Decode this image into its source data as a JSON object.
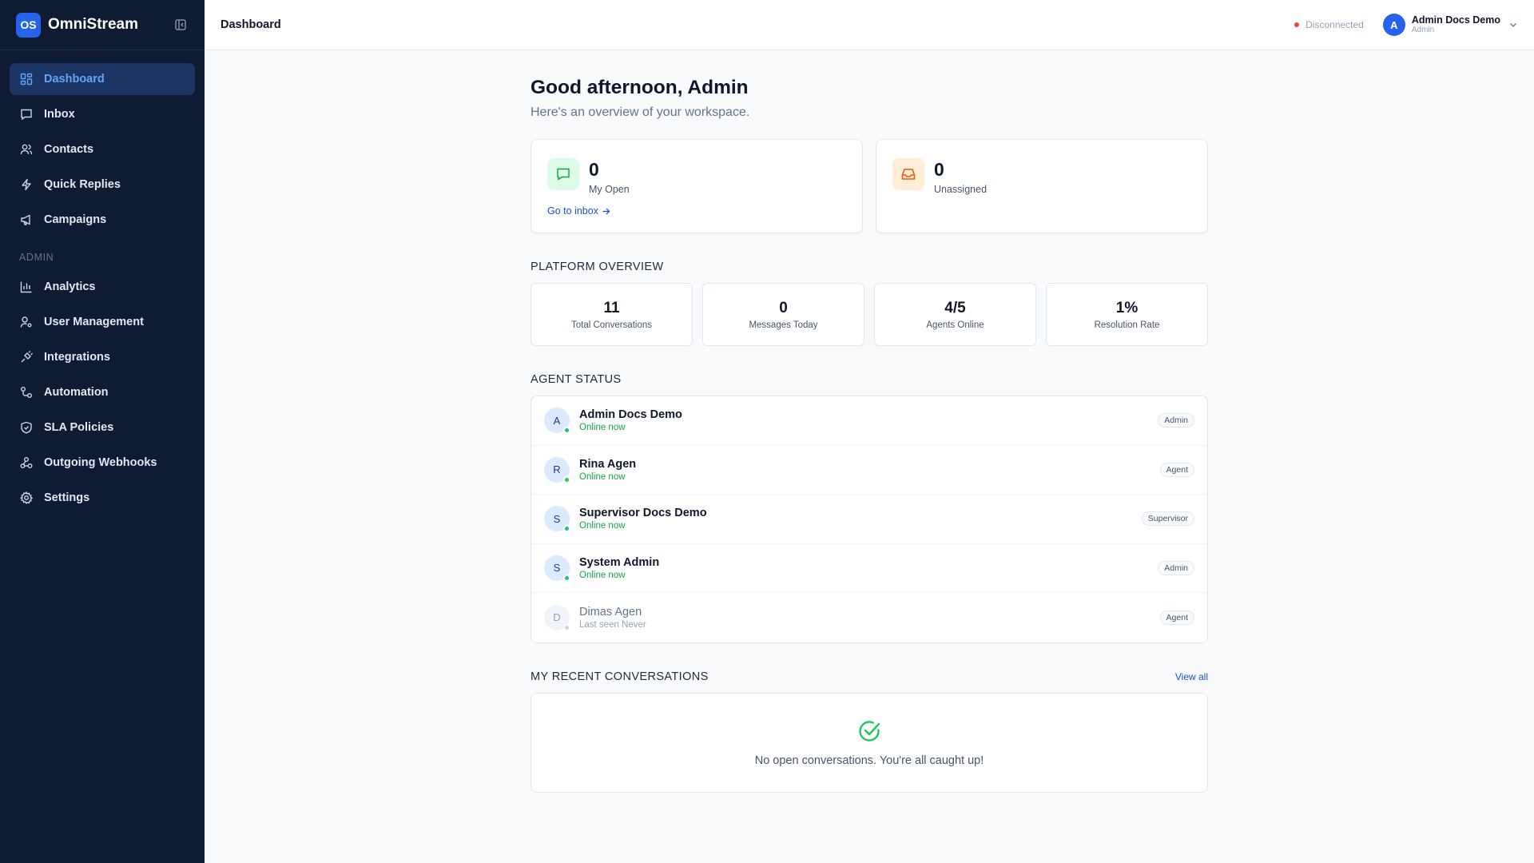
{
  "brand": {
    "logo": "OS",
    "name": "OmniStream"
  },
  "sidebar": {
    "items": [
      {
        "label": "Dashboard",
        "icon": "dashboard-icon"
      },
      {
        "label": "Inbox",
        "icon": "chat-icon"
      },
      {
        "label": "Contacts",
        "icon": "users-icon"
      },
      {
        "label": "Quick Replies",
        "icon": "bolt-icon"
      },
      {
        "label": "Campaigns",
        "icon": "megaphone-icon"
      }
    ],
    "admin_section": "ADMIN",
    "admin_items": [
      {
        "label": "Analytics",
        "icon": "bar-chart-icon"
      },
      {
        "label": "User Management",
        "icon": "user-cog-icon"
      },
      {
        "label": "Integrations",
        "icon": "plug-icon"
      },
      {
        "label": "Automation",
        "icon": "workflow-icon"
      },
      {
        "label": "SLA Policies",
        "icon": "shield-icon"
      },
      {
        "label": "Outgoing Webhooks",
        "icon": "webhook-icon"
      },
      {
        "label": "Settings",
        "icon": "gear-icon"
      }
    ]
  },
  "topbar": {
    "title": "Dashboard",
    "connection": "Disconnected",
    "user": {
      "initial": "A",
      "name": "Admin Docs Demo",
      "role": "Admin"
    }
  },
  "main": {
    "greeting": "Good afternoon, Admin",
    "subtitle": "Here's an overview of your workspace.",
    "cards": [
      {
        "value": "0",
        "label": "My Open",
        "link": "Go to inbox"
      },
      {
        "value": "0",
        "label": "Unassigned"
      }
    ],
    "platform_title": "PLATFORM OVERVIEW",
    "stats": [
      {
        "value": "11",
        "label": "Total Conversations"
      },
      {
        "value": "0",
        "label": "Messages Today"
      },
      {
        "value": "4/5",
        "label": "Agents Online"
      },
      {
        "value": "1%",
        "label": "Resolution Rate"
      }
    ],
    "agent_title": "AGENT STATUS",
    "agents": [
      {
        "initial": "A",
        "name": "Admin Docs Demo",
        "status": "Online now",
        "role": "Admin"
      },
      {
        "initial": "R",
        "name": "Rina Agen",
        "status": "Online now",
        "role": "Agent"
      },
      {
        "initial": "S",
        "name": "Supervisor Docs Demo",
        "status": "Online now",
        "role": "Supervisor"
      },
      {
        "initial": "S",
        "name": "System Admin",
        "status": "Online now",
        "role": "Admin"
      },
      {
        "initial": "D",
        "name": "Dimas Agen",
        "status": "Last seen Never",
        "role": "Agent"
      }
    ],
    "recent_title": "MY RECENT CONVERSATIONS",
    "view_all": "View all",
    "empty_text": "No open conversations. You're all caught up!"
  },
  "colors": {
    "sidebar_bg": "#0f1a33",
    "accent": "#2563eb",
    "online": "#22c55e",
    "disconnected": "#ef4444"
  }
}
